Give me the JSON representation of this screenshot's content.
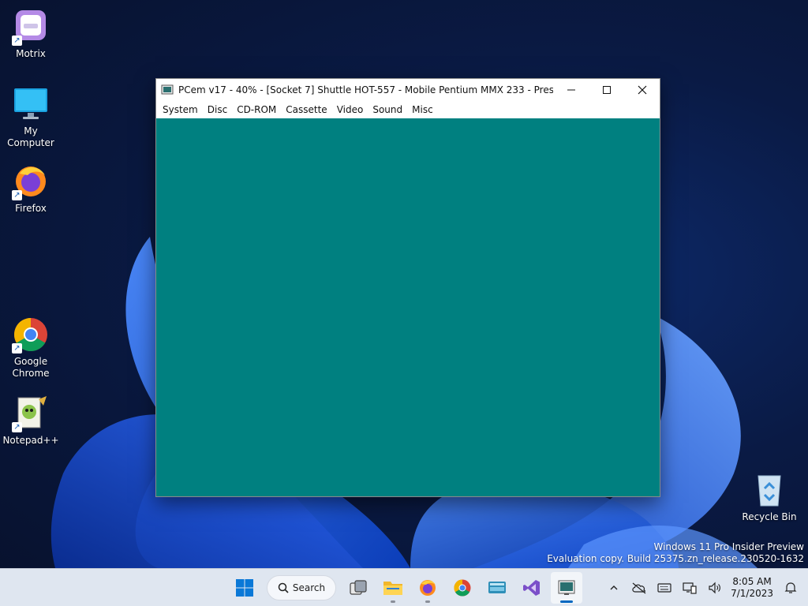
{
  "desktop": {
    "icons": [
      {
        "label": "Motrix"
      },
      {
        "label": "My Computer"
      },
      {
        "label": "Firefox"
      },
      {
        "label": "Google Chrome"
      },
      {
        "label": "Notepad++"
      },
      {
        "label": "Recycle Bin"
      }
    ]
  },
  "window": {
    "title": "PCem v17 - 40% - [Socket 7] Shuttle HOT-557 - Mobile Pentium MMX 233 - Press CTRL...",
    "menu": [
      "System",
      "Disc",
      "CD-ROM",
      "Cassette",
      "Video",
      "Sound",
      "Misc"
    ],
    "screen_color": "#008080"
  },
  "watermark": {
    "line1": "Windows 11 Pro Insider Preview",
    "line2": "Evaluation copy. Build 25375.zn_release.230520-1632"
  },
  "taskbar": {
    "search_label": "Search",
    "time": "8:05 AM",
    "date": "7/1/2023"
  }
}
